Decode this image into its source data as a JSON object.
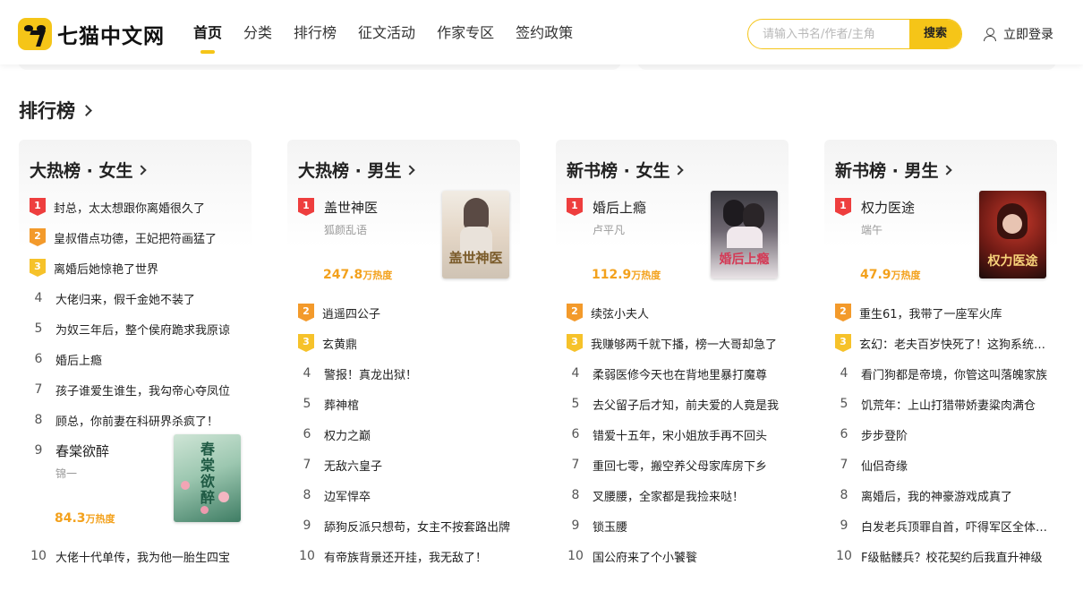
{
  "logo": {
    "text": "七猫中文网"
  },
  "nav": {
    "items": [
      "首页",
      "分类",
      "排行榜",
      "征文活动",
      "作家专区",
      "签约政策"
    ]
  },
  "search": {
    "placeholder": "请输入书名/作者/主角",
    "button": "搜索"
  },
  "login": {
    "label": "立即登录"
  },
  "section": {
    "title": "排行榜"
  },
  "colors": {
    "accent": "#f5c518",
    "rank1": "#ee3e3e",
    "rank2": "#f39a2b",
    "rank3": "#f6c22a",
    "heat": "#f3a11c"
  },
  "columns": [
    {
      "title": "大热榜 · 女生",
      "rows": [
        {
          "rank": "1",
          "title": "封总，太太想跟你离婚很久了"
        },
        {
          "rank": "2",
          "title": "皇叔借点功德，王妃把符画猛了"
        },
        {
          "rank": "3",
          "title": "离婚后她惊艳了世界"
        },
        {
          "rank": "4",
          "title": "大佬归来，假千金她不装了"
        },
        {
          "rank": "5",
          "title": "为奴三年后，整个侯府跪求我原谅"
        },
        {
          "rank": "6",
          "title": "婚后上瘾"
        },
        {
          "rank": "7",
          "title": "孩子谁爱生谁生，我勾帝心夺凤位"
        },
        {
          "rank": "8",
          "title": "顾总，你前妻在科研界杀疯了！"
        }
      ],
      "featured": {
        "rank": "9",
        "title": "春棠欲醉",
        "author": "锦一",
        "heat": "84.3",
        "heat_unit": "万热度",
        "cover_text": "春棠欲醉"
      },
      "after": [
        {
          "rank": "10",
          "title": "大佬十代单传，我为他一胎生四宝"
        }
      ]
    },
    {
      "title": "大热榜 · 男生",
      "featured": {
        "rank": "1",
        "title": "盖世神医",
        "author": "狐颜乱语",
        "heat": "247.8",
        "heat_unit": "万热度",
        "cover_text": "盖世神医"
      },
      "rows": [
        {
          "rank": "2",
          "title": "逍遥四公子"
        },
        {
          "rank": "3",
          "title": "玄黄鼎"
        },
        {
          "rank": "4",
          "title": "警报！真龙出狱！"
        },
        {
          "rank": "5",
          "title": "葬神棺"
        },
        {
          "rank": "6",
          "title": "权力之巅"
        },
        {
          "rank": "7",
          "title": "无敌六皇子"
        },
        {
          "rank": "8",
          "title": "边军悍卒"
        },
        {
          "rank": "9",
          "title": "舔狗反派只想苟，女主不按套路出牌"
        },
        {
          "rank": "10",
          "title": "有帝族背景还开挂，我无敌了！"
        }
      ]
    },
    {
      "title": "新书榜 · 女生",
      "featured": {
        "rank": "1",
        "title": "婚后上瘾",
        "author": "卢平凡",
        "heat": "112.9",
        "heat_unit": "万热度",
        "cover_text": "婚后上瘾"
      },
      "rows": [
        {
          "rank": "2",
          "title": "续弦小夫人"
        },
        {
          "rank": "3",
          "title": "我赚够两千就下播，榜一大哥却急了"
        },
        {
          "rank": "4",
          "title": "柔弱医修今天也在背地里暴打魔尊"
        },
        {
          "rank": "5",
          "title": "去父留子后才知，前夫爱的人竟是我"
        },
        {
          "rank": "6",
          "title": "错爱十五年，宋小姐放手再不回头"
        },
        {
          "rank": "7",
          "title": "重回七零，搬空养父母家库房下乡"
        },
        {
          "rank": "8",
          "title": "叉腰腰，全家都是我捡来哒！"
        },
        {
          "rank": "9",
          "title": "锁玉腰"
        },
        {
          "rank": "10",
          "title": "国公府来了个小饕餮"
        }
      ]
    },
    {
      "title": "新书榜 · 男生",
      "featured": {
        "rank": "1",
        "title": "权力医途",
        "author": "端午",
        "heat": "47.9",
        "heat_unit": "万热度",
        "cover_text": "权力医途"
      },
      "rows": [
        {
          "rank": "2",
          "title": "重生61，我带了一座军火库"
        },
        {
          "rank": "3",
          "title": "玄幻：老夫百岁快死了！这狗系统才来"
        },
        {
          "rank": "4",
          "title": "看门狗都是帝境，你管这叫落魄家族"
        },
        {
          "rank": "5",
          "title": "饥荒年：上山打猎带娇妻粱肉满仓"
        },
        {
          "rank": "6",
          "title": "步步登阶"
        },
        {
          "rank": "7",
          "title": "仙侣奇缘"
        },
        {
          "rank": "8",
          "title": "离婚后，我的神豪游戏成真了"
        },
        {
          "rank": "9",
          "title": "白发老兵顶罪自首，吓得军区全体出动"
        },
        {
          "rank": "10",
          "title": "F级骷髅兵？校花契约后我直升神级"
        }
      ]
    }
  ]
}
